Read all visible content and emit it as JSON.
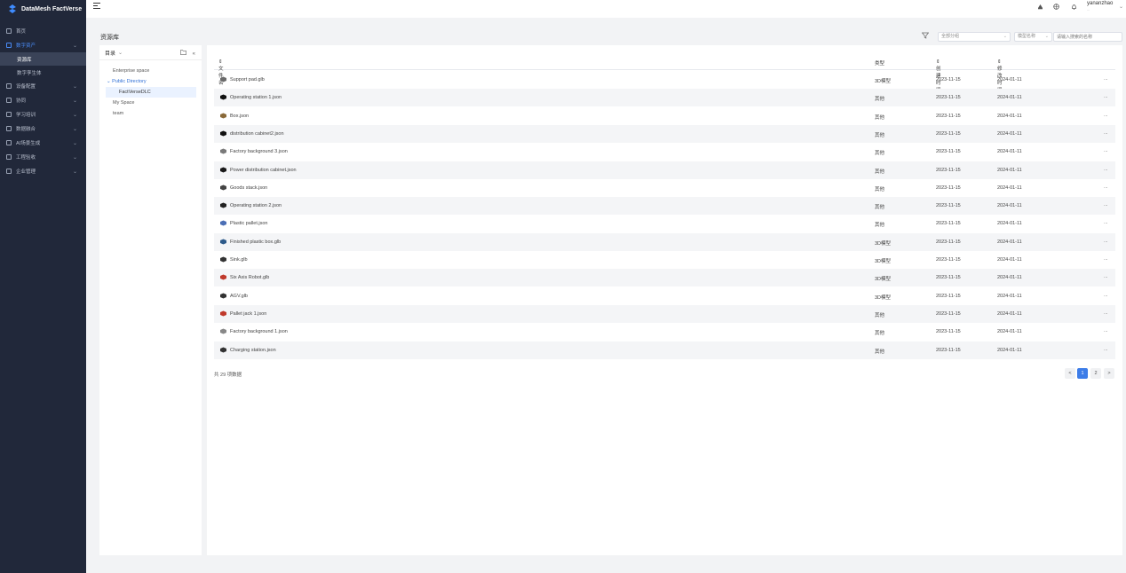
{
  "app": {
    "title": "DataMesh FactVerse"
  },
  "sidebar": {
    "items": [
      {
        "label": "首页",
        "icon": "home-icon",
        "has_children": false
      },
      {
        "label": "数字资产",
        "icon": "cube-icon",
        "has_children": true,
        "active": true
      },
      {
        "label": "设备配置",
        "icon": "device-icon",
        "has_children": true
      },
      {
        "label": "协同",
        "icon": "users-icon",
        "has_children": true
      },
      {
        "label": "学习培训",
        "icon": "book-icon",
        "has_children": true
      },
      {
        "label": "数据融合",
        "icon": "link-icon",
        "has_children": true
      },
      {
        "label": "AI场景生成",
        "icon": "ai-icon",
        "has_children": true
      },
      {
        "label": "工程验收",
        "icon": "calendar-icon",
        "has_children": true
      },
      {
        "label": "企业管理",
        "icon": "building-icon",
        "has_children": true
      }
    ],
    "sub_items": [
      {
        "label": "资源库",
        "selected": true
      },
      {
        "label": "数字孪生体",
        "selected": false
      }
    ]
  },
  "header": {
    "username": "yananzhao",
    "user_sub": "..."
  },
  "page": {
    "title": "资源库",
    "filters": {
      "scope_value": "全部分组",
      "type_value": "模型名称",
      "search_placeholder": "请输入搜索的名称"
    }
  },
  "tree": {
    "header_label": "目录",
    "nodes": [
      {
        "label": "Enterprise space",
        "kind": "root"
      },
      {
        "label": "Public Directory",
        "kind": "open"
      },
      {
        "label": "FactVerseDLC",
        "kind": "child"
      },
      {
        "label": "My Space",
        "kind": "root"
      },
      {
        "label": "team",
        "kind": "root"
      }
    ]
  },
  "table": {
    "columns": {
      "name": "文件名",
      "type": "类型",
      "created": "创建时间",
      "modified": "修改时间"
    },
    "rows": [
      {
        "name": "Support pad.glb",
        "type": "3D模型",
        "created": "2023-11-15",
        "modified": "2024-01-11",
        "icon": "pad-icon",
        "icon_color": "#6b6b6b"
      },
      {
        "name": "Operating station 1.json",
        "type": "其他",
        "created": "2023-11-15",
        "modified": "2024-01-11",
        "icon": "station-icon",
        "icon_color": "#111111"
      },
      {
        "name": "Box.json",
        "type": "其他",
        "created": "2023-11-15",
        "modified": "2024-01-11",
        "icon": "box-icon",
        "icon_color": "#8a6a3a"
      },
      {
        "name": "distribution cabinet2.json",
        "type": "其他",
        "created": "2023-11-15",
        "modified": "2024-01-11",
        "icon": "cabinet-icon",
        "icon_color": "#111111"
      },
      {
        "name": "Factory background 3.json",
        "type": "其他",
        "created": "2023-11-15",
        "modified": "2024-01-11",
        "icon": "factory-icon",
        "icon_color": "#7a7a7a"
      },
      {
        "name": "Power distribution cabinet.json",
        "type": "其他",
        "created": "2023-11-15",
        "modified": "2024-01-11",
        "icon": "cabinet-icon",
        "icon_color": "#1a1a1a"
      },
      {
        "name": "Goods stack.json",
        "type": "其他",
        "created": "2023-11-15",
        "modified": "2024-01-11",
        "icon": "stack-icon",
        "icon_color": "#444444"
      },
      {
        "name": "Operating station 2.json",
        "type": "其他",
        "created": "2023-11-15",
        "modified": "2024-01-11",
        "icon": "station-icon",
        "icon_color": "#222222"
      },
      {
        "name": "Plastic pallet.json",
        "type": "其他",
        "created": "2023-11-15",
        "modified": "2024-01-11",
        "icon": "pallet-icon",
        "icon_color": "#4b6fb5"
      },
      {
        "name": "Finished plastic box.glb",
        "type": "3D模型",
        "created": "2023-11-15",
        "modified": "2024-01-11",
        "icon": "plastic-box-icon",
        "icon_color": "#2d5a8a"
      },
      {
        "name": "Sink.glb",
        "type": "3D模型",
        "created": "2023-11-15",
        "modified": "2024-01-11",
        "icon": "sink-icon",
        "icon_color": "#333333"
      },
      {
        "name": "Six Axis Robot.glb",
        "type": "3D模型",
        "created": "2023-11-15",
        "modified": "2024-01-11",
        "icon": "robot-icon",
        "icon_color": "#c0392b"
      },
      {
        "name": "AGV.glb",
        "type": "3D模型",
        "created": "2023-11-15",
        "modified": "2024-01-11",
        "icon": "agv-icon",
        "icon_color": "#333333"
      },
      {
        "name": "Pallet jack 1.json",
        "type": "其他",
        "created": "2023-11-15",
        "modified": "2024-01-11",
        "icon": "pallet-jack-icon",
        "icon_color": "#c0392b"
      },
      {
        "name": "Factory background 1.json",
        "type": "其他",
        "created": "2023-11-15",
        "modified": "2024-01-11",
        "icon": "factory-icon",
        "icon_color": "#888888"
      },
      {
        "name": "Charging station.json",
        "type": "其他",
        "created": "2023-11-15",
        "modified": "2024-01-11",
        "icon": "charger-icon",
        "icon_color": "#333333"
      }
    ],
    "more_label": "...",
    "total_label": "共 29 项数据"
  },
  "pagination": {
    "prev": "<",
    "pages": [
      "1",
      "2"
    ],
    "next": ">",
    "current": "1"
  }
}
